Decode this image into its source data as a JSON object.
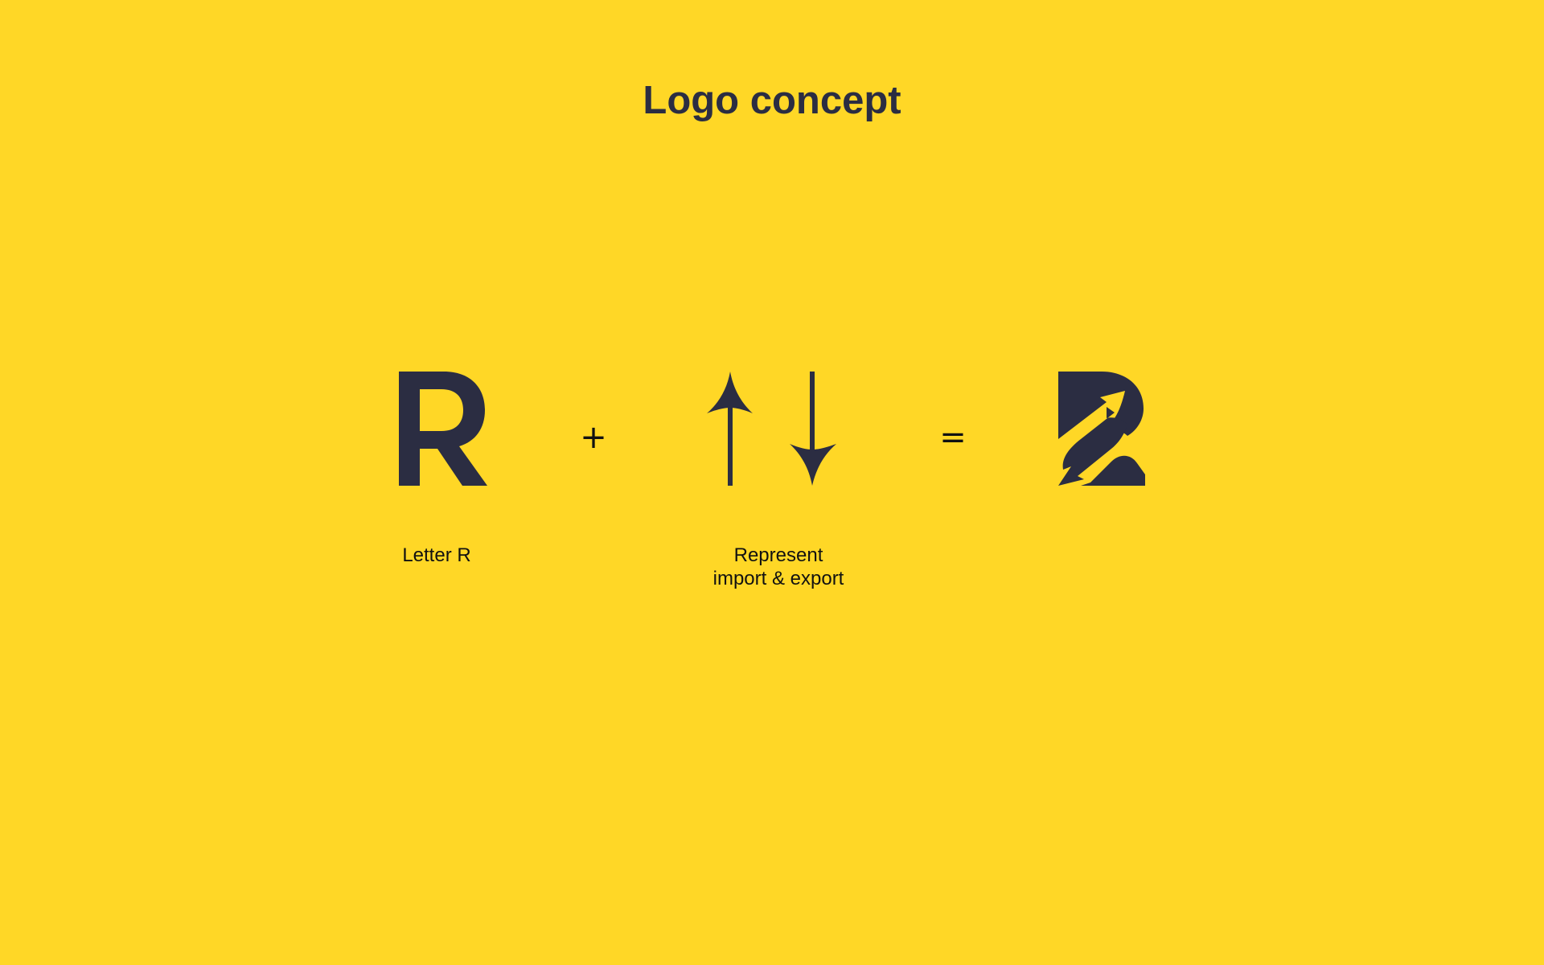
{
  "title": "Logo concept",
  "steps": [
    {
      "glyph": "letter-r-icon",
      "caption": [
        "Letter R"
      ]
    },
    {
      "glyph": "up-down-arrows-icon",
      "caption": [
        "Represent",
        "import & export"
      ]
    },
    {
      "glyph": "combined-r-arrow-logo-icon",
      "caption": []
    }
  ],
  "operators": {
    "plus": "+",
    "equals": "="
  },
  "colors": {
    "background": "#FFD726",
    "foreground": "#2B2D42",
    "text": "#111111"
  }
}
